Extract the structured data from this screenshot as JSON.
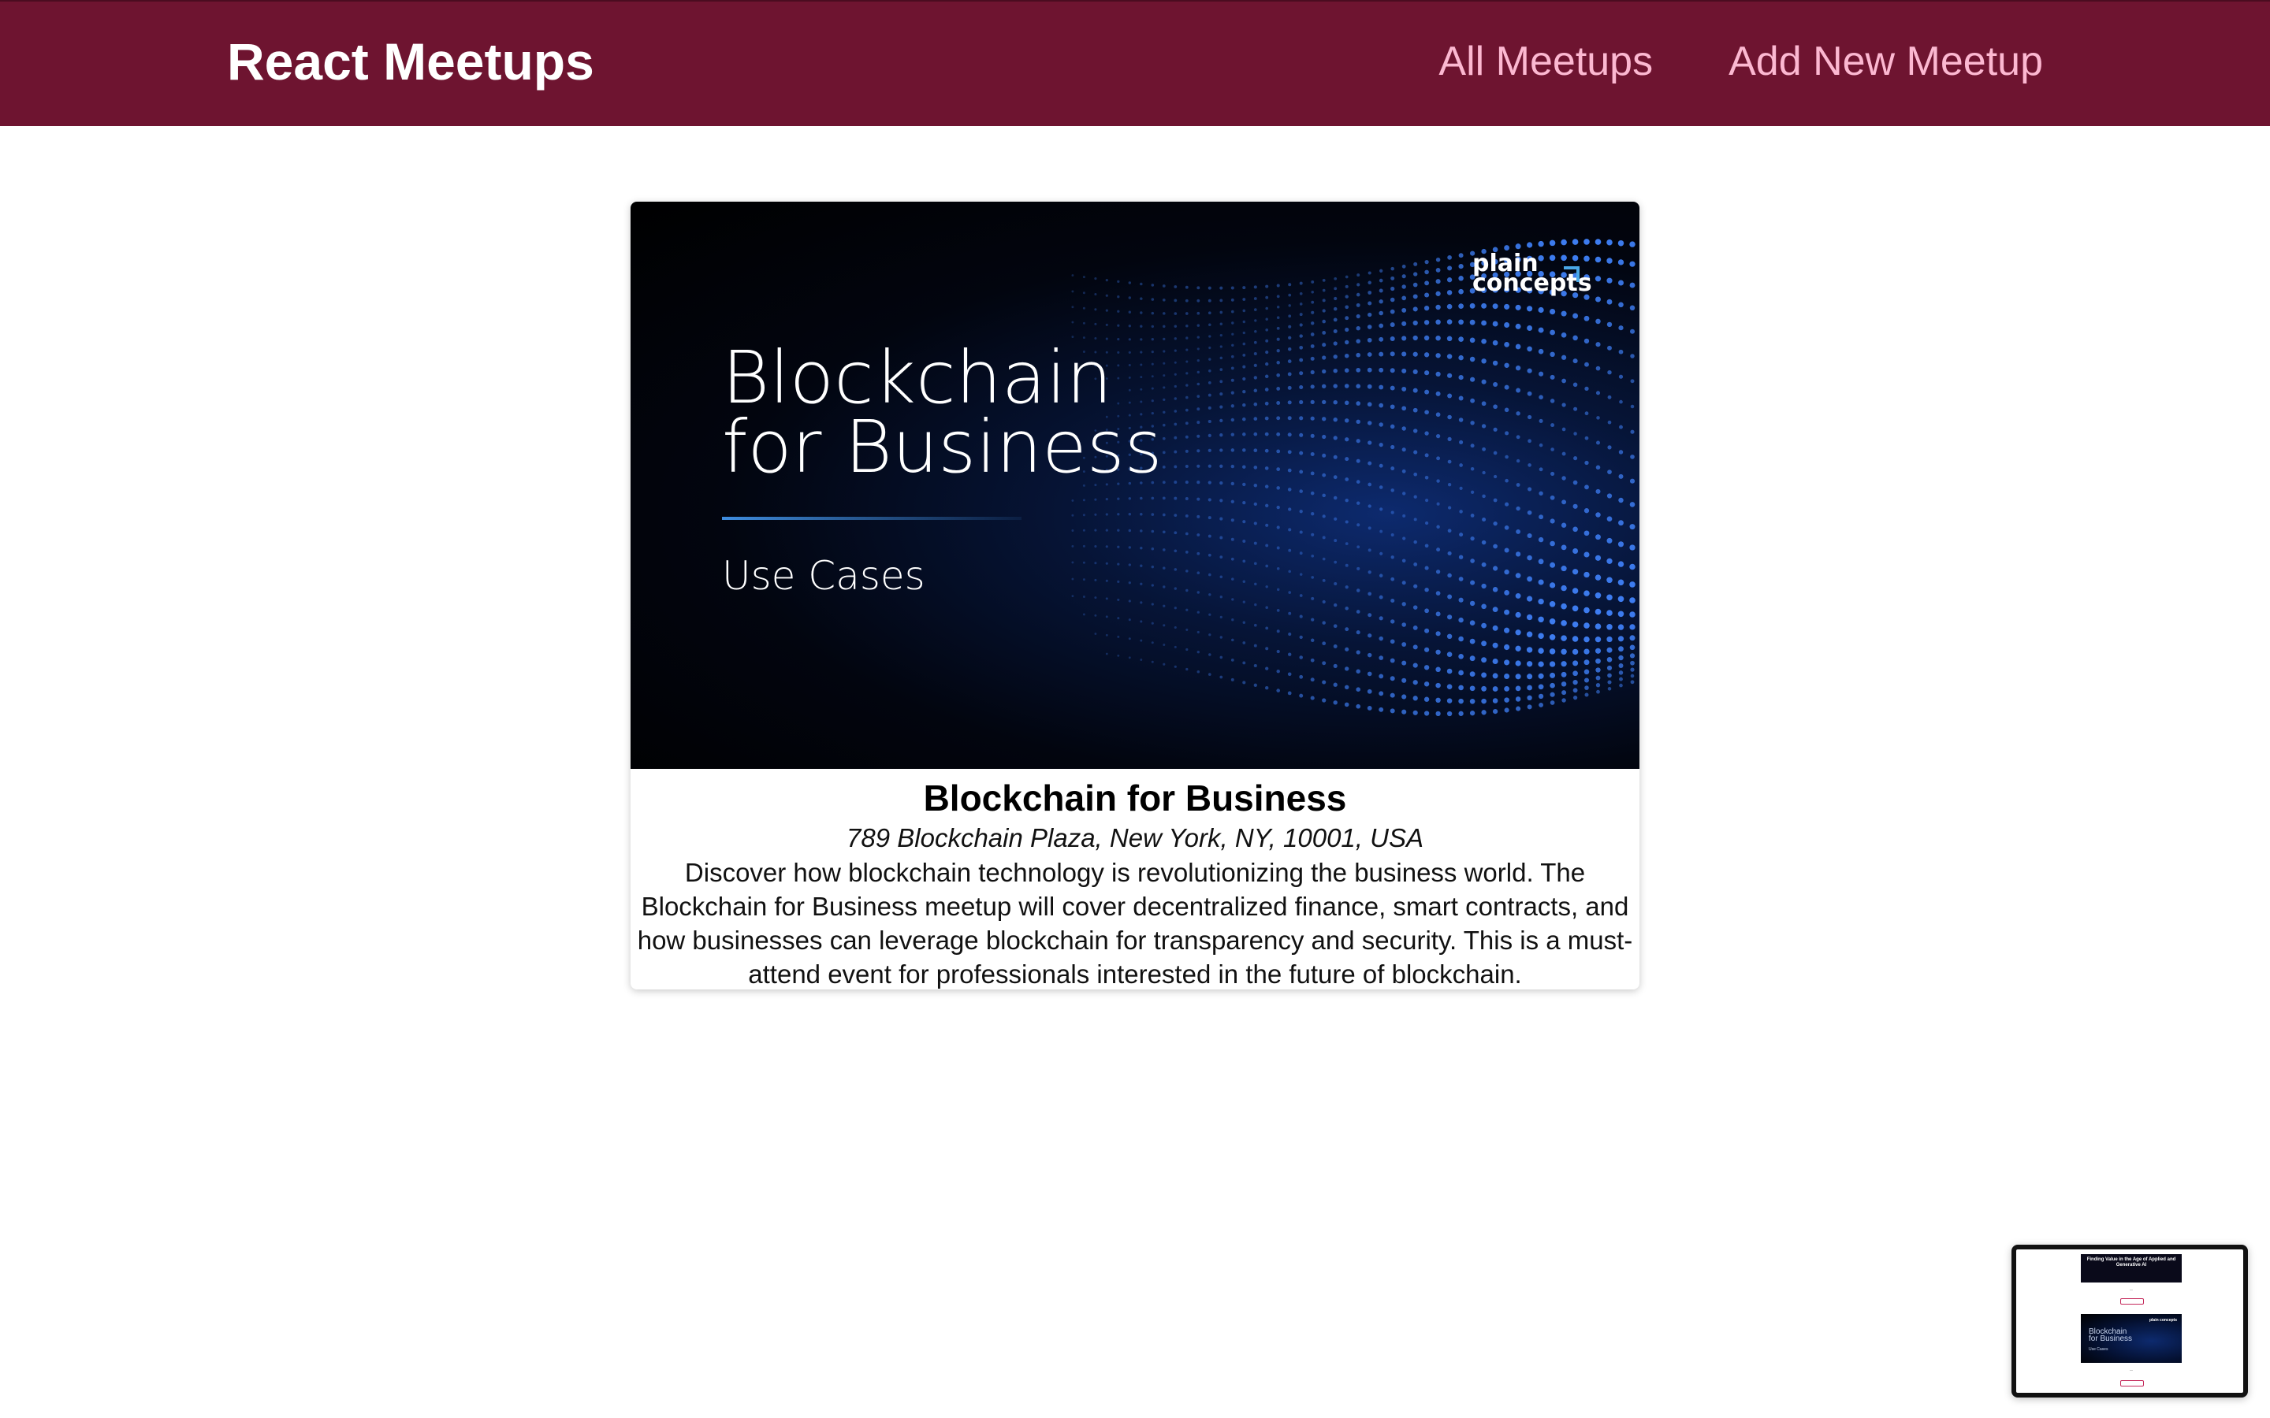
{
  "header": {
    "logo": "React Meetups",
    "nav": [
      {
        "label": "All Meetups"
      },
      {
        "label": "Add New Meetup"
      }
    ],
    "background_color": "#6e1430",
    "nav_link_color": "#fcb8d1"
  },
  "meetup": {
    "image": {
      "title_line1": "Blockchain",
      "title_line2": "for Business",
      "subtitle": "Use Cases",
      "brand_line1": "plain",
      "brand_line2": "concepts"
    },
    "title": "Blockchain for Business",
    "address": "789 Blockchain Plaza, New York, NY, 10001, USA",
    "description": "Discover how blockchain technology is revolutionizing the business world. The Blockchain for Business meetup will cover decentralized finance, smart contracts, and how businesses can leverage blockchain for transparency and security. This is a must-attend event for professionals interested in the future of blockchain."
  },
  "preview_thumbnail": {
    "card1_title": "Finding Value in the Age of Applied and Generative AI",
    "card2_title_line1": "Blockchain",
    "card2_title_line2": "for Business",
    "card2_subtitle": "Use Cases",
    "card2_brand": "plain concepts"
  }
}
